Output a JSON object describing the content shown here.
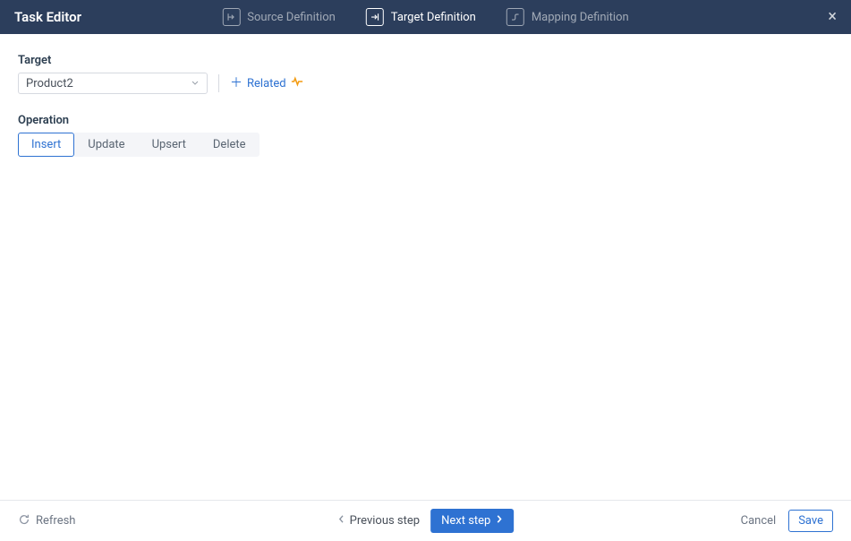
{
  "header": {
    "title": "Task Editor",
    "tabs": [
      {
        "label": "Source Definition"
      },
      {
        "label": "Target Definition"
      },
      {
        "label": "Mapping Definition"
      }
    ],
    "close": "×"
  },
  "target": {
    "label": "Target",
    "value": "Product2",
    "related_label": "Related"
  },
  "operation": {
    "label": "Operation",
    "options": [
      "Insert",
      "Update",
      "Upsert",
      "Delete"
    ],
    "selected": "Insert"
  },
  "footer": {
    "refresh": "Refresh",
    "prev": "Previous step",
    "next": "Next step",
    "cancel": "Cancel",
    "save": "Save"
  }
}
